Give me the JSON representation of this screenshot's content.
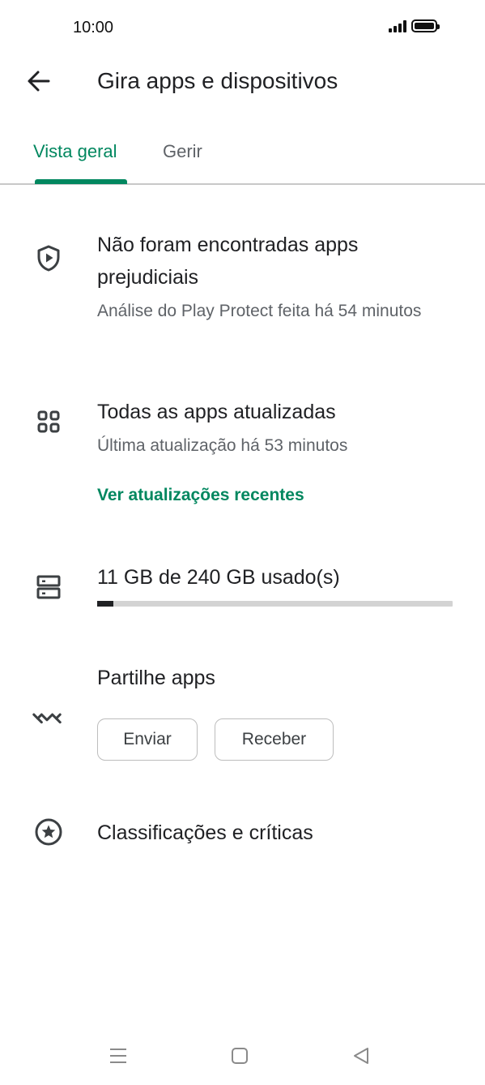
{
  "status_bar": {
    "time": "10:00",
    "icons": [
      "signal-icon",
      "battery-icon"
    ]
  },
  "header": {
    "title": "Gira apps e dispositivos",
    "back_icon": "arrow-back-icon"
  },
  "tabs": [
    {
      "label": "Vista geral",
      "selected": true
    },
    {
      "label": "Gerir",
      "selected": false
    }
  ],
  "protect": {
    "icon": "shield-play-icon",
    "title": "Não foram encontradas apps prejudiciais",
    "subtitle": "Análise do Play Protect feita há 54 minutos"
  },
  "updates": {
    "icon": "apps-grid-icon",
    "title": "Todas as apps atualizadas",
    "subtitle": "Última atualização há 53 minutos",
    "link": "Ver atualizações recentes"
  },
  "storage": {
    "icon": "storage-icon",
    "label": "11 GB de 240 GB usado(s)",
    "used_gb": 11,
    "total_gb": 240
  },
  "share": {
    "icon": "nearby-share-icon",
    "title": "Partilhe apps",
    "send_label": "Enviar",
    "receive_label": "Receber"
  },
  "ratings": {
    "icon": "star-circle-icon",
    "title": "Classificações e críticas"
  },
  "nav_bar": [
    "menu-icon",
    "home-icon",
    "back-triangle-icon"
  ],
  "colors": {
    "accent": "#01875f",
    "text_primary": "#202124",
    "text_secondary": "#5f6368"
  }
}
